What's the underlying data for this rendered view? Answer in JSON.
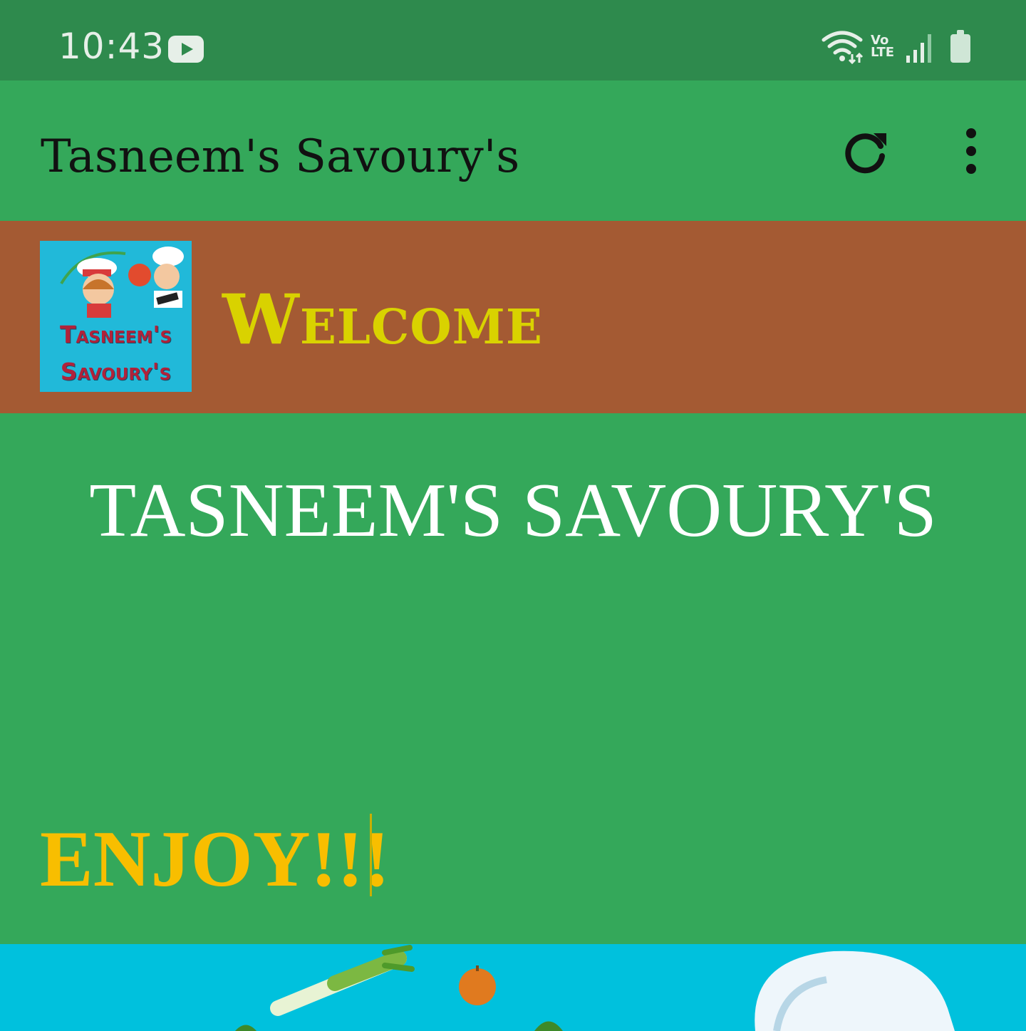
{
  "status_bar": {
    "time": "10:43",
    "notification_icon": "youtube-icon",
    "right_icons": [
      "wifi-icon",
      "volte-icon",
      "signal-icon",
      "battery-icon"
    ],
    "volte_label_top": "Vo",
    "volte_label_bottom": "LTE"
  },
  "app_bar": {
    "title": "Tasneem's Savoury's",
    "actions": [
      "refresh-icon",
      "more-vert-icon"
    ]
  },
  "welcome_band": {
    "logo_line1": "Tasneem's",
    "logo_line2": "Savoury's",
    "heading": "Welcome"
  },
  "main": {
    "title": "TASNEEM'S SAVOURY'S",
    "enjoy": "ENJOY!!!"
  },
  "colors": {
    "status_bar": "#2e8a4d",
    "app_bar": "#34a85a",
    "welcome_band": "#a45a33",
    "welcome_text": "#d9d200",
    "enjoy_text": "#f8be00",
    "banner": "#00c1dd"
  }
}
